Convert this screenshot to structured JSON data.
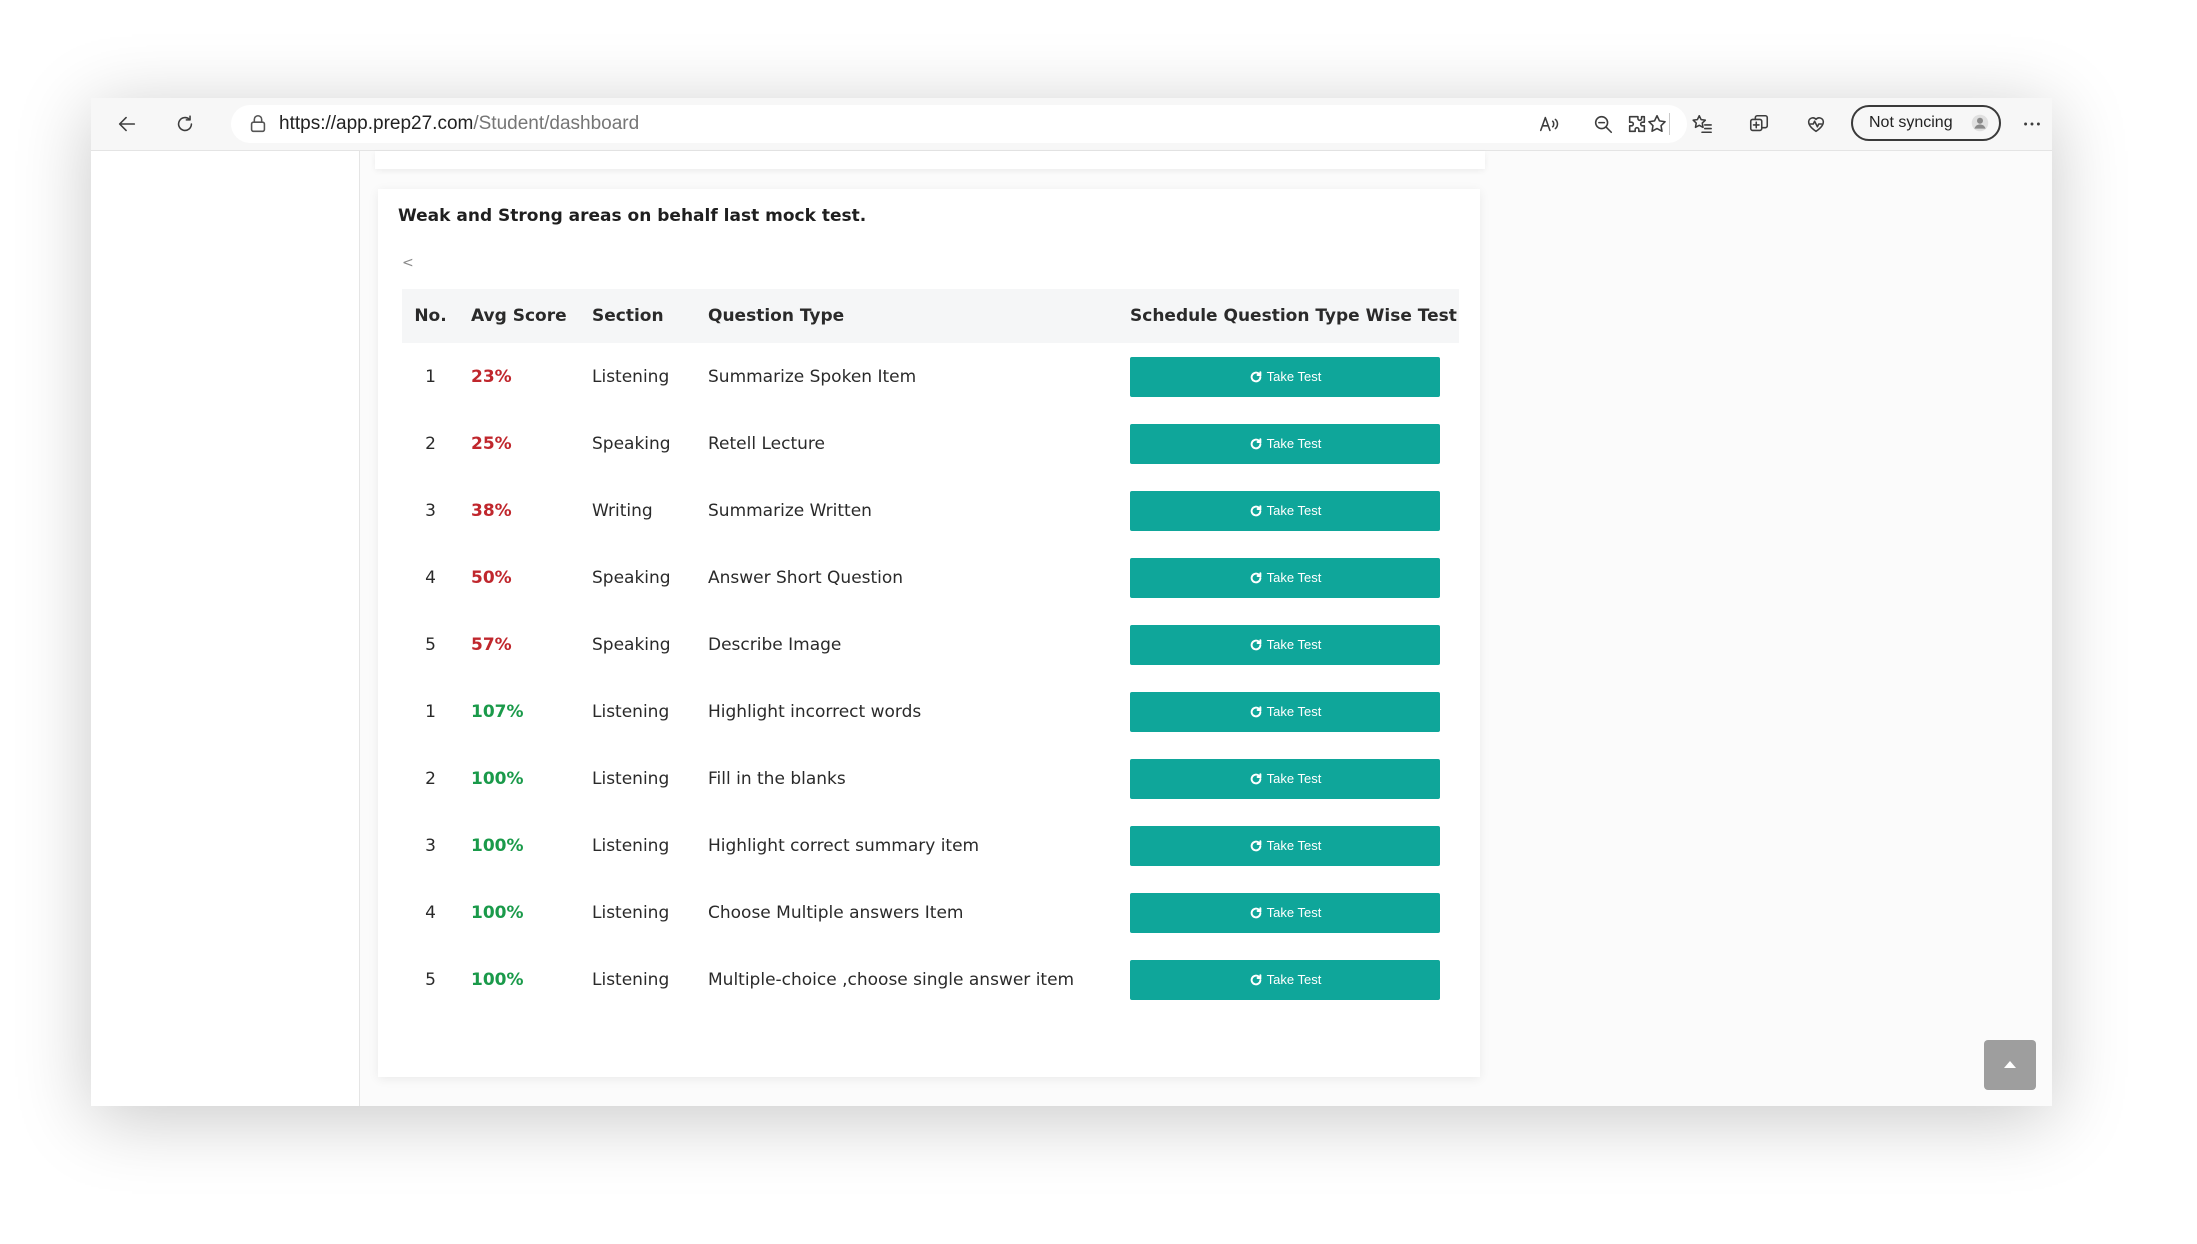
{
  "browser": {
    "url_host": "https://app.prep27.com",
    "url_path": "/Student/dashboard",
    "sync_label": "Not syncing"
  },
  "card": {
    "title": "Weak and Strong areas on behalf last mock test.",
    "scroll_hint": "<"
  },
  "table": {
    "headers": [
      "No.",
      "Avg Score",
      "Section",
      "Question Type",
      "Schedule Question Type Wise Test"
    ],
    "button_label": "Take Test",
    "rows": [
      {
        "no": "1",
        "score": "23%",
        "section": "Listening",
        "type": "Summarize Spoken Item",
        "level": "weak"
      },
      {
        "no": "2",
        "score": "25%",
        "section": "Speaking",
        "type": "Retell Lecture",
        "level": "weak"
      },
      {
        "no": "3",
        "score": "38%",
        "section": "Writing",
        "type": "Summarize Written",
        "level": "weak"
      },
      {
        "no": "4",
        "score": "50%",
        "section": "Speaking",
        "type": "Answer Short Question",
        "level": "weak"
      },
      {
        "no": "5",
        "score": "57%",
        "section": "Speaking",
        "type": "Describe Image",
        "level": "weak"
      },
      {
        "no": "1",
        "score": "107%",
        "section": "Listening",
        "type": "Highlight incorrect words",
        "level": "strong"
      },
      {
        "no": "2",
        "score": "100%",
        "section": "Listening",
        "type": "Fill in the blanks",
        "level": "strong"
      },
      {
        "no": "3",
        "score": "100%",
        "section": "Listening",
        "type": "Highlight correct summary item",
        "level": "strong"
      },
      {
        "no": "4",
        "score": "100%",
        "section": "Listening",
        "type": "Choose Multiple answers Item",
        "level": "strong"
      },
      {
        "no": "5",
        "score": "100%",
        "section": "Listening",
        "type": "Multiple-choice ,choose single answer item",
        "level": "strong"
      }
    ]
  },
  "colors": {
    "accent": "#0fa69a",
    "weak": "#c0272d",
    "strong": "#1a9a4a",
    "scroll_top_bg": "#9e9e9e"
  },
  "icons": {
    "back": "back-arrow-icon",
    "refresh": "refresh-icon",
    "lock": "lock-icon",
    "read_aloud": "read-aloud-icon",
    "zoom": "zoom-out-icon",
    "favorite": "star-icon",
    "extensions": "puzzle-icon",
    "favorites_bar": "favorites-icon",
    "collections": "collections-icon",
    "performance": "heart-pulse-icon",
    "more": "more-icon",
    "take_test": "redo-icon",
    "scroll_top": "chevron-up-icon"
  }
}
